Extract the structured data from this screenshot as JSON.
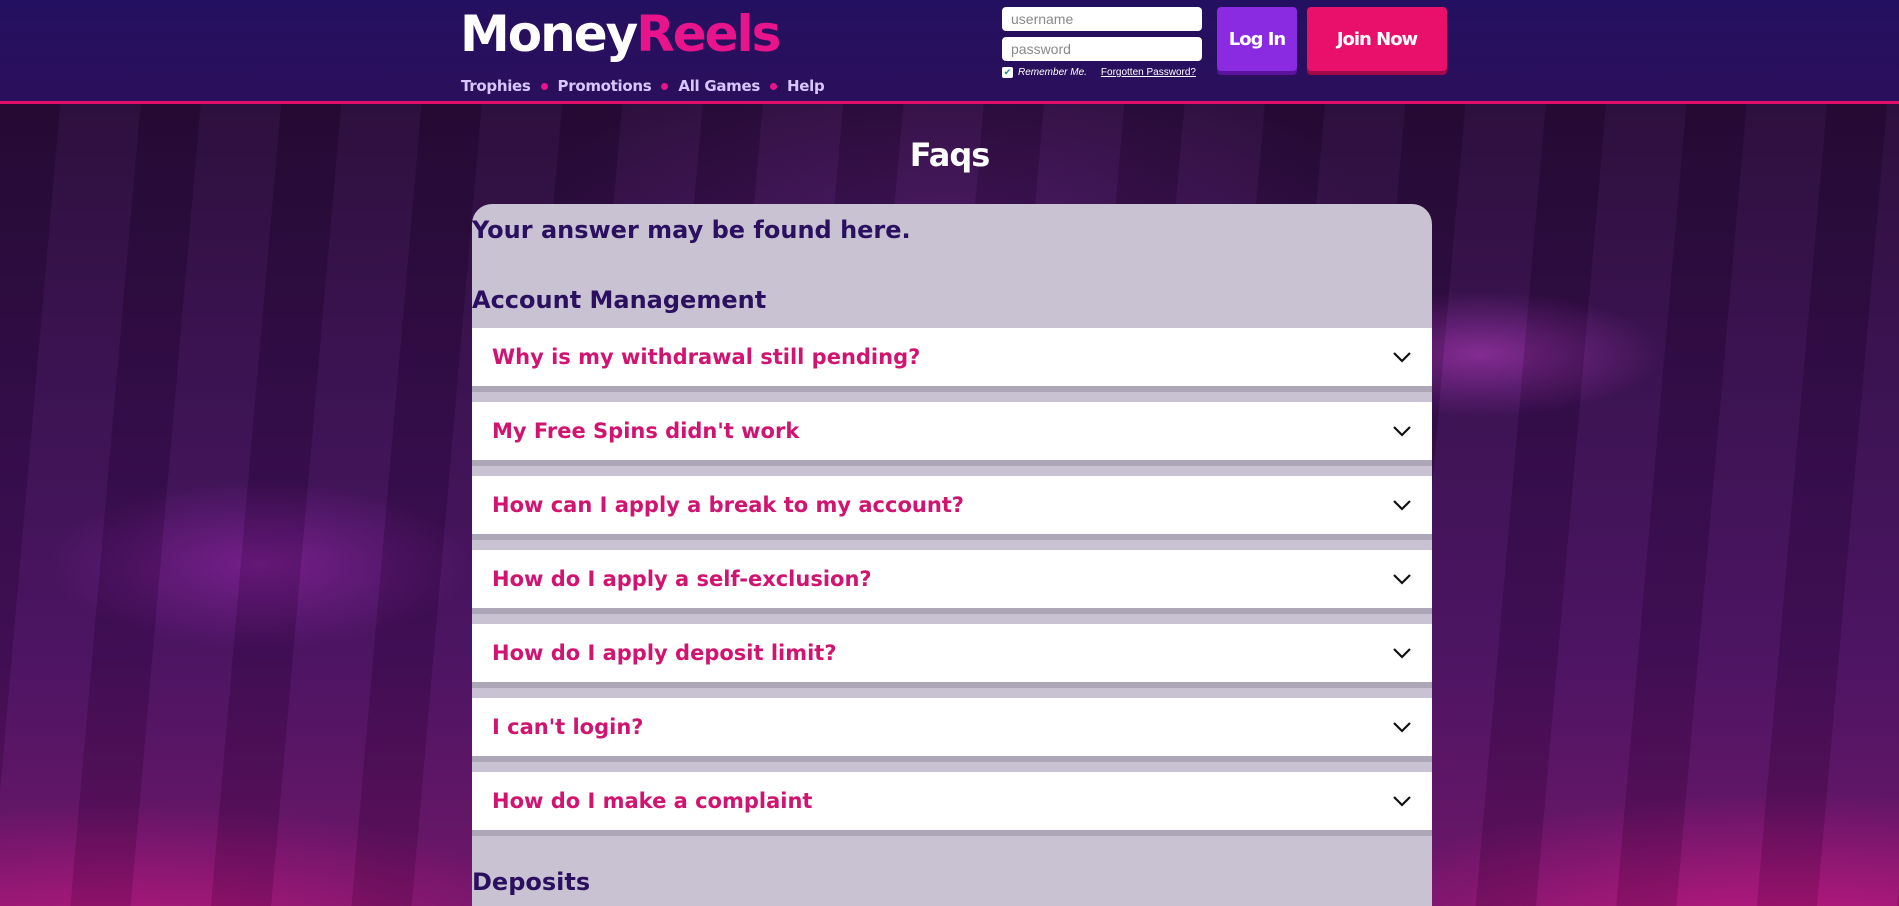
{
  "header": {
    "logo_part1": "Money",
    "logo_part2": "Reels",
    "nav": [
      "Trophies",
      "Promotions",
      "All Games",
      "Help"
    ],
    "username_placeholder": "username",
    "password_placeholder": "password",
    "remember_label": "Remember Me.",
    "remember_checked": true,
    "forgot_label": "Forgotten Password?",
    "login_label": "Log In",
    "join_label": "Join Now"
  },
  "page": {
    "title": "Faqs",
    "intro": "Your answer may be found here."
  },
  "sections": [
    {
      "title": "Account Management",
      "faqs": [
        "Why is my withdrawal still pending?",
        "My Free Spins didn't work",
        "How can I apply a break to my account?",
        "How do I apply a self-exclusion?",
        "How do I apply deposit limit?",
        "I can't login?",
        "How do I make a complaint"
      ]
    },
    {
      "title": "Deposits",
      "faqs": []
    }
  ],
  "icons": {
    "chevron": "chevron-down-icon",
    "check": "checkbox-checked-icon"
  },
  "colors": {
    "accent": "#e8148c",
    "header_bg": "#241060",
    "question": "#d0146f",
    "heading": "#2b1060",
    "login_btn": "#8a2be2",
    "join_btn": "#e8106a"
  }
}
